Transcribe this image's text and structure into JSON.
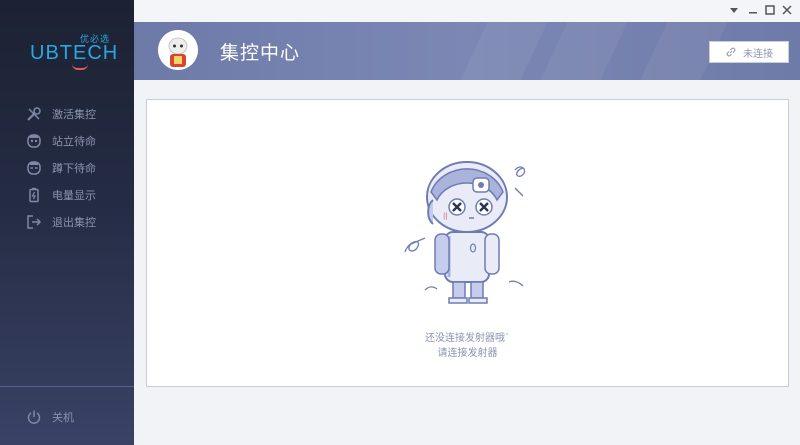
{
  "brand": {
    "tagline": "优必选",
    "wordmark": "UBTECH"
  },
  "sidebar": {
    "items": [
      {
        "label": "激活集控",
        "icon": "tools-icon"
      },
      {
        "label": "站立待命",
        "icon": "robot-face-icon"
      },
      {
        "label": "蹲下待命",
        "icon": "robot-face-icon"
      },
      {
        "label": "电量显示",
        "icon": "battery-icon"
      },
      {
        "label": "退出集控",
        "icon": "exit-icon"
      }
    ],
    "power": {
      "label": "关机",
      "icon": "power-icon"
    }
  },
  "window": {
    "controls": [
      "dropdown-icon",
      "minimize-icon",
      "maximize-icon",
      "close-icon"
    ]
  },
  "header": {
    "title": "集控中心",
    "connection_label": "未连接",
    "connection_icon": "link-icon"
  },
  "main": {
    "message_line1": "还没连接发射器哦`",
    "message_line2": "请连接发射器"
  },
  "colors": {
    "sidebar": "#242c44",
    "header": "#7581b0",
    "accent": "#2aa7e2",
    "text_muted": "#8b93b0"
  }
}
